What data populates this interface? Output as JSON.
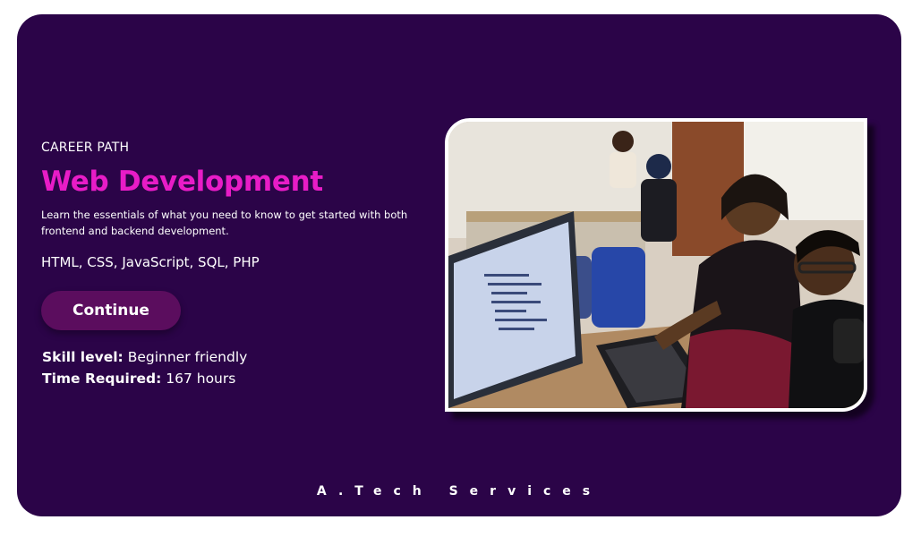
{
  "card": {
    "eyebrow": "CAREER PATH",
    "title": "Web Development",
    "description": "Learn the essentials of what you need to know to get started with both frontend and backend development.",
    "technologies": "HTML, CSS, JavaScript, SQL, PHP",
    "continue_label": "Continue",
    "skill_level_label": "Skill level:",
    "skill_level_value": "Beginner friendly",
    "time_required_label": "Time Required:",
    "time_required_value": "167 hours"
  },
  "image": {
    "description_icon": "photo-people-at-laptop"
  },
  "footer": {
    "brand": "A.Tech Services"
  },
  "colors": {
    "card_background": "#2b0448",
    "title_accent": "#e81cc7",
    "button_background": "#5b0d5e"
  }
}
